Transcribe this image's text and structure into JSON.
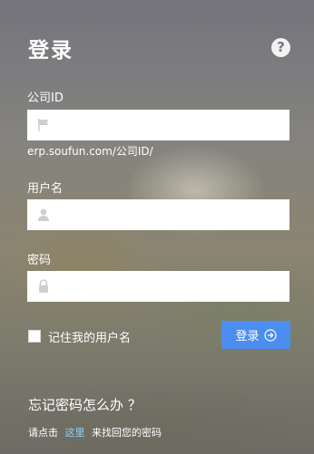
{
  "header": {
    "title": "登录",
    "help_icon": "question-circle-icon"
  },
  "company_field": {
    "label": "公司ID",
    "value": "",
    "placeholder": "",
    "icon": "flag-icon",
    "hint": "erp.soufun.com/公司ID/"
  },
  "username_field": {
    "label": "用户名",
    "value": "",
    "placeholder": "",
    "icon": "user-icon"
  },
  "password_field": {
    "label": "密码",
    "value": "",
    "placeholder": "",
    "icon": "lock-icon"
  },
  "remember": {
    "label": "记住我的用户名",
    "checked": false
  },
  "login_button": {
    "label": "登录",
    "icon": "arrow-right-circle-icon",
    "color": "#4b8ef0"
  },
  "forgot": {
    "title": "忘记密码怎么办 ？",
    "prefix": "请点击",
    "link_text": "这里",
    "suffix": "来找回您的密码",
    "link_color": "#8fd3ff"
  }
}
